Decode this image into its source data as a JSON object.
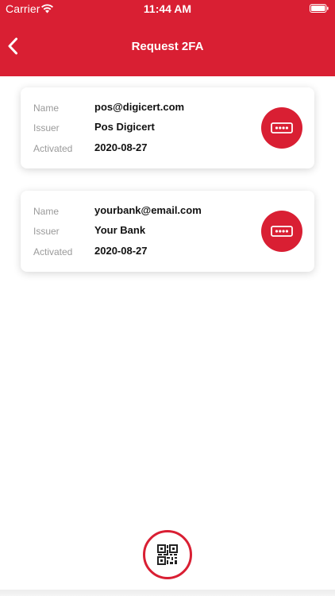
{
  "status_bar": {
    "carrier": "Carrier",
    "time": "11:44 AM",
    "icons": [
      "wifi-icon",
      "battery-icon"
    ]
  },
  "header": {
    "title": "Request 2FA",
    "back_icon": "chevron-left-icon",
    "background_color": "#d91f33"
  },
  "accounts": [
    {
      "name_label": "Name",
      "name": "pos@digicert.com",
      "issuer_label": "Issuer",
      "issuer": "Pos Digicert",
      "activated_label": "Activated",
      "activated": "2020-08-27",
      "action_icon": "password-key-icon"
    },
    {
      "name_label": "Name",
      "name": "yourbank@email.com",
      "issuer_label": "Issuer",
      "issuer": "Your Bank",
      "activated_label": "Activated",
      "activated": "2020-08-27",
      "action_icon": "password-key-icon"
    }
  ],
  "footer": {
    "scan_icon": "qr-code-icon"
  },
  "colors": {
    "accent": "#d91f33",
    "label": "#9a9a9a",
    "value": "#111111"
  }
}
